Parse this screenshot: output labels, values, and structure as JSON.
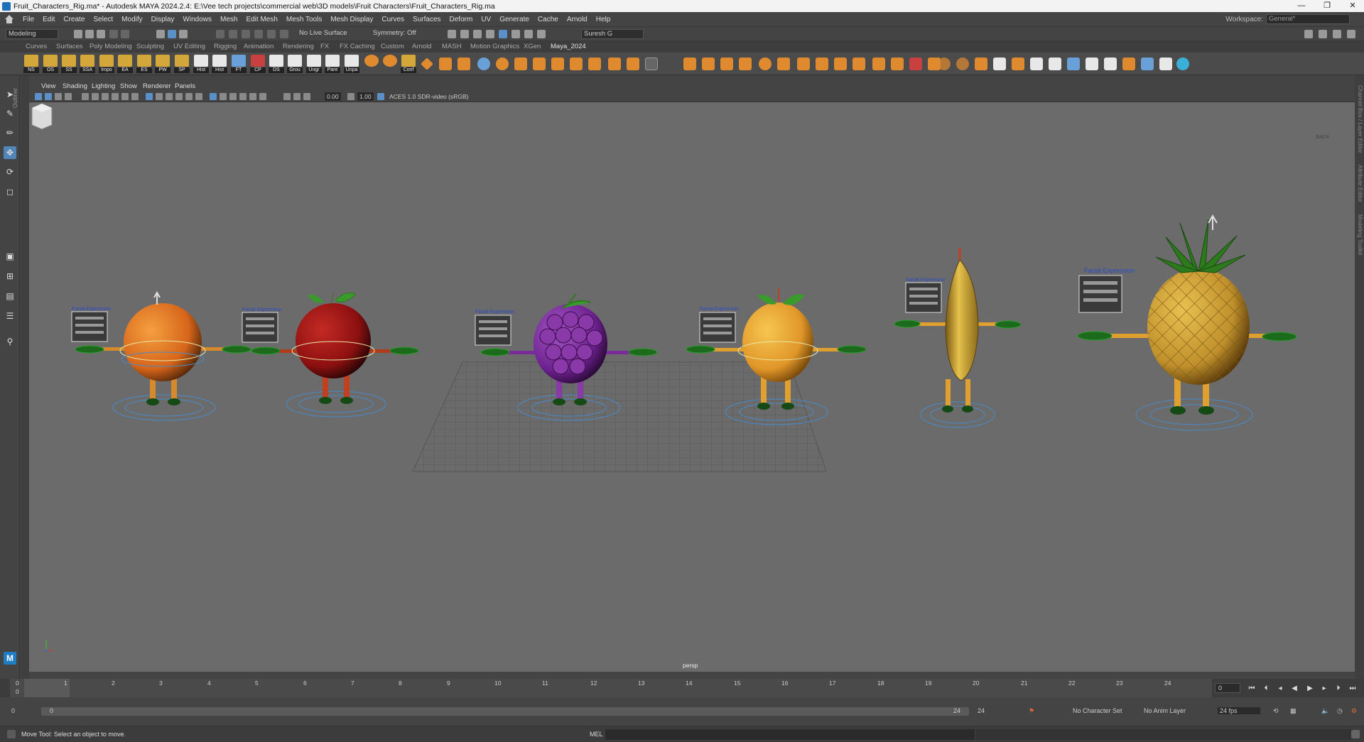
{
  "window": {
    "title": "Fruit_Characters_Rig.ma* - Autodesk MAYA 2024.2.4: E:\\Vee tech projects\\commercial web\\3D models\\Fruit Characters\\Fruit_Characters_Rig.ma",
    "minimize": "—",
    "restore": "❐",
    "close": "✕"
  },
  "menubar": {
    "items": [
      "File",
      "Edit",
      "Create",
      "Select",
      "Modify",
      "Display",
      "Windows",
      "Mesh",
      "Edit Mesh",
      "Mesh Tools",
      "Mesh Display",
      "Curves",
      "Surfaces",
      "Deform",
      "UV",
      "Generate",
      "Cache",
      "Arnold",
      "Help"
    ],
    "workspace_label": "Workspace:",
    "workspace_value": "General*"
  },
  "statusline": {
    "menu_set": "Modeling",
    "live_surface": "No Live Surface",
    "symmetry": "Symmetry: Off",
    "user": "Suresh G"
  },
  "shelf": {
    "tabs": [
      "Curves",
      "Surfaces",
      "Poly Modeling",
      "Sculpting",
      "UV Editing",
      "Rigging",
      "Animation",
      "Rendering",
      "FX",
      "FX Caching",
      "Custom",
      "Arnold",
      "MASH",
      "Motion Graphics",
      "XGen",
      "Maya_2024"
    ],
    "active_tab": "Maya_2024",
    "buttons": [
      "NS",
      "OS",
      "SS",
      "SSA",
      "Impo",
      "EA",
      "ES",
      "PW",
      "SP",
      "Hist",
      "Hist",
      "FT",
      "CP",
      "DS",
      "Grou",
      "Ungr",
      "Pare",
      "Unpa",
      "",
      "",
      "Conf"
    ]
  },
  "panel": {
    "menus": [
      "View",
      "Shading",
      "Lighting",
      "Show",
      "Renderer",
      "Panels"
    ],
    "exposure": "0.00",
    "gamma": "1.00",
    "color_space": "ACES 1.0 SDR-video (sRGB)"
  },
  "viewport": {
    "camera": "persp",
    "viewcube_label": "BACK",
    "facial_label": "Facial Expression",
    "characters": [
      {
        "name": "orange",
        "color": "#e0741b"
      },
      {
        "name": "apple",
        "color": "#9c1414"
      },
      {
        "name": "grape",
        "color": "#7b2a9e"
      },
      {
        "name": "mango",
        "color": "#f0a830"
      },
      {
        "name": "banana",
        "color": "#e4c04a"
      },
      {
        "name": "pineapple",
        "color": "#d6a63a"
      }
    ]
  },
  "outliner_label": "Outliner",
  "right_strip": [
    "Channel Box / Layer Editor",
    "Attribute Editor",
    "Modeling Toolkit"
  ],
  "timeline": {
    "ticks": [
      "0",
      "1",
      "2",
      "3",
      "4",
      "5",
      "6",
      "7",
      "8",
      "9",
      "10",
      "11",
      "12",
      "13",
      "14",
      "15",
      "16",
      "17",
      "18",
      "19",
      "20",
      "21",
      "22",
      "23",
      "24"
    ],
    "current_frame": "0",
    "playhead_label": "0"
  },
  "range": {
    "start": "0",
    "inner_start": "0",
    "inner_end": "24",
    "end": "24",
    "character_set": "No Character Set",
    "anim_layer": "No Anim Layer",
    "fps": "24 fps"
  },
  "helpline": {
    "text": "Move Tool: Select an object to move.",
    "mel": "MEL"
  }
}
